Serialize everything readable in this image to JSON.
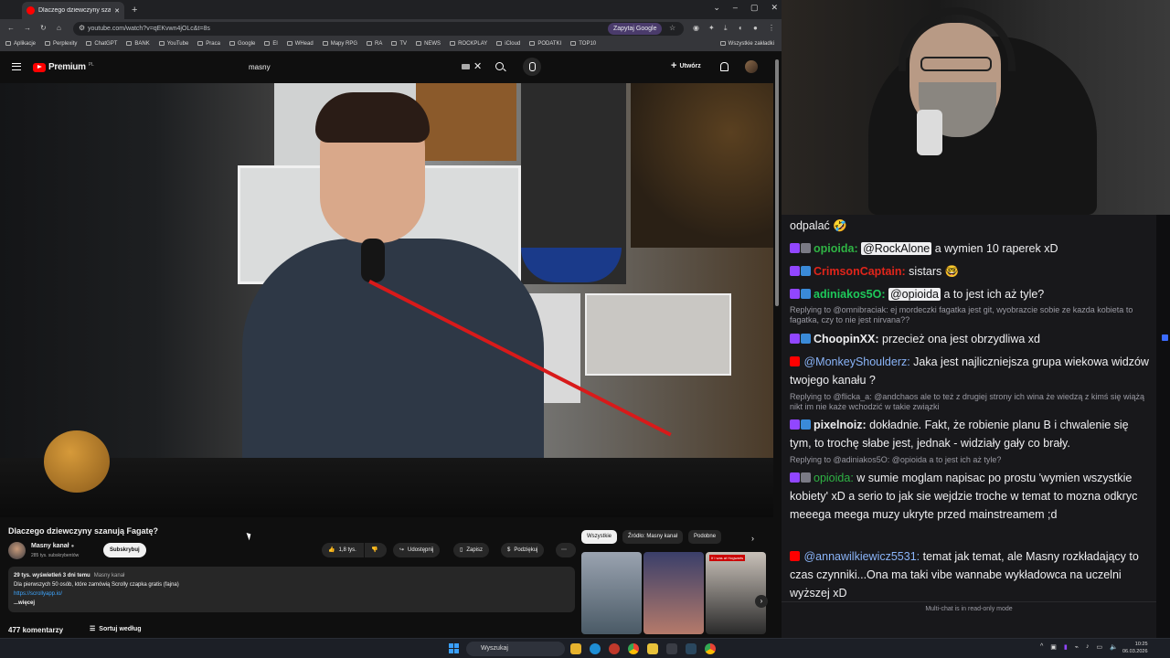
{
  "browser": {
    "tab_title": "Dlaczego dziewczyny szanują F...",
    "url": "youtube.com/watch?v=qEKvwn4jOLc&t=8s",
    "ask_google": "Zapytaj Google",
    "bookmarks": [
      "Aplikacje",
      "Perplexity",
      "ChatGPT",
      "BANK",
      "YouTube",
      "Praca",
      "Google",
      "El",
      "WHead",
      "Mapy RPG",
      "RA",
      "TV",
      "NEWS",
      "ROCKPLAY",
      "iCloud",
      "PODATKI",
      "TOP10"
    ],
    "all_bookmarks": "Wszystkie zakładki"
  },
  "youtube": {
    "logo": "Premium",
    "logo_cc": "PL",
    "search_value": "masny",
    "create_label": "Utwórz",
    "video": {
      "title": "Dlaczego dziewczyny szanują Fagatę?",
      "channel": "Masny kanał",
      "subscribers": "285 tys. subskrybentów",
      "subscribe_label": "Subskrybuj",
      "likes": "1,8 tys.",
      "share": "Udostępnij",
      "save": "Zapisz",
      "thanks": "Podziękuj",
      "views": "29 tys. wyświetleń  3 dni temu",
      "desc_channel": "Masny kanał",
      "desc_line": "Dla pierwszych 50 osób, które zamówią Scrolly czapka gratis (fajna)",
      "desc_link": "https://scrollyapp.io/",
      "more": "...więcej",
      "comments": "477 komentarzy",
      "sort": "Sortuj według"
    },
    "chips": [
      "Wszystkie",
      "Źródło: Masny kanał",
      "Podobne"
    ],
    "thumb_label": "If I was at Hogwarts"
  },
  "chat": {
    "messages": [
      {
        "text": "odpalać 🤣"
      },
      {
        "platform": "twitch",
        "user": "opioida:",
        "color": "#2fb344",
        "mention": "@RockAlone",
        "text": " a wymien 10 raperek xD"
      },
      {
        "platform": "twitch",
        "user": "CrimsonCaptain:",
        "color": "#e0251b",
        "text": " sistars 🤓"
      },
      {
        "platform": "twitch",
        "user": "adiniakos5O:",
        "color": "#1ec85a",
        "mention": "@opioida",
        "text": " a to jest ich aż tyle?"
      },
      {
        "reply": "Replying to @omnibraciak: ej mordeczki fagatka jest git, wyobrazcie sobie ze kazda kobieta to fagatka, czy to nie jest nirvana??"
      },
      {
        "platform": "twitch",
        "user": "ChoopinXX:",
        "color": "#efeff1",
        "text": " przecież ona jest obrzydliwa xd"
      },
      {
        "platform": "youtube",
        "user": "@MonkeyShoulderz:",
        "color": "#8ab4f8",
        "text": " Jaka jest najliczniejsza grupa wiekowa widzów twojego kanału ?"
      },
      {
        "reply": "Replying to @flicka_a: @andchaos ale to też z drugiej strony ich wina że wiedzą z kimś się wiążą nikt im nie każe wchodzić w takie związki"
      },
      {
        "platform": "twitch",
        "user": "pixelnoiz:",
        "color": "#efeff1",
        "text": " dokładnie. Fakt, że robienie planu B i chwalenie się tym, to trochę słabe jest, jednak - widziały gały co brały."
      },
      {
        "reply": "Replying to @adiniakos5O: @opioida a to jest ich aż tyle?"
      },
      {
        "platform": "twitch",
        "user": "opioida:",
        "color": "#2fb344",
        "text": " w sumie moglam napisac po prostu 'wymien wszystkie kobiety' xD a serio to jak sie wejdzie troche w temat to mozna odkryc meeega meega muzy ukryte przed mainstreamem ;d"
      },
      {
        "platform": "youtube",
        "user": "@annawilkiewicz5531:",
        "color": "#8ab4f8",
        "text": " temat jak temat, ale Masny rozkładający to czas czynniki...Ona ma taki vibe wannabe wykładowca na uczelni wyższej xD"
      }
    ],
    "footer": "Multi-chat is in read-only mode"
  },
  "taskbar": {
    "search": "Wyszukaj",
    "time": "10:25",
    "date": "06.03.2026"
  },
  "colors": {
    "yt_red": "#ff0000",
    "twitch_purple": "#9146ff",
    "link_blue": "#3ea6ff"
  }
}
